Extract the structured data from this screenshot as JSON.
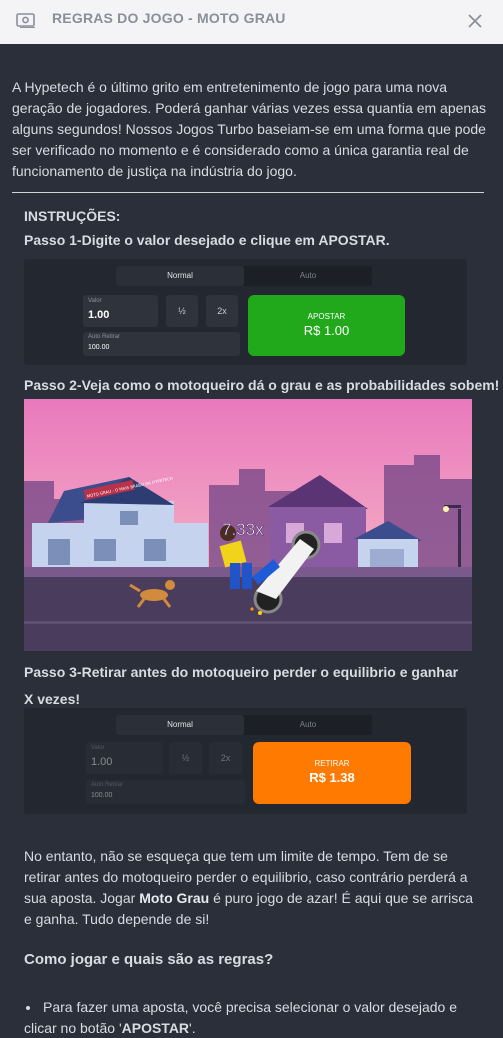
{
  "header": {
    "title": "REGRAS DO JOGO - MOTO GRAU",
    "ticket_icon": "ticket-icon",
    "close_icon": "close-icon"
  },
  "intro": "A Hypetech é o último grito em entretenimento de jogo para uma nova geração de jogadores. Poderá ganhar várias vezes essa quantia em apenas alguns segundos! Nossos Jogos Turbo baseiam-se em uma forma que pode ser verificado no momento e é considerado como a única garantia real de funcionamento de justiça na indústria do jogo.",
  "instructions": {
    "heading": "INSTRUÇÕES:",
    "step1": "Passo 1-Digite o valor desejado e clique em APOSTAR.",
    "step2": "Passo 2-Veja como o motoqueiro dá o grau e as probabilidades sobem!",
    "step3": "Passo 3-Retirar antes do motoqueiro perder o equilibrio e ganhar X vezes!"
  },
  "demo_bet": {
    "tab_normal": "Normal",
    "tab_auto": "Auto",
    "value_label": "Valor",
    "value": "1.00",
    "half": "½",
    "double": "2x",
    "auto_retirar_label": "Auto Retirar",
    "auto_retirar_value": "100.00",
    "button_line1": "APOSTAR",
    "button_line2": "R$ 1.00"
  },
  "demo_cashout": {
    "tab_normal": "Normal",
    "tab_auto": "Auto",
    "value_label": "Valor",
    "value": "1.00",
    "half": "½",
    "double": "2x",
    "auto_retirar_label": "Auto Retirar",
    "auto_retirar_value": "100.00",
    "button_line1": "RETIRAR",
    "button_line2": "R$ 1.38"
  },
  "game": {
    "multiplier": "7.33x",
    "sign_text": "MOTO GRAU - O MAIS BRABO DA HYPETECH"
  },
  "note": {
    "before": "No entanto, não se esqueça que tem um limite de tempo. Tem de se retirar antes do motoqueiro perder o equilibrio, caso contrário perderá a sua aposta. Jogar ",
    "bold": "Moto Grau",
    "after": " é puro jogo de azar! É aqui que se arrisca e ganha. Tudo depende de si!"
  },
  "rules": {
    "heading": "Como jogar e quais são as regras?",
    "bullet_before": "Para fazer uma aposta, você precisa selecionar o valor desejado e clicar no botão '",
    "bullet_bold": "APOSTAR",
    "bullet_after": "'."
  },
  "colors": {
    "background": "#2a2f3a",
    "header_bg": "#f4f4f6",
    "bet_button": "#22a81b",
    "cashout_button": "#ff7a00"
  }
}
